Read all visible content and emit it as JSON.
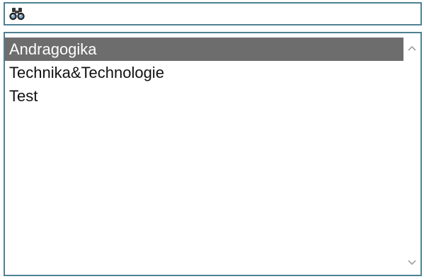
{
  "search": {
    "icon": "binoculars-icon",
    "value": "",
    "placeholder": ""
  },
  "list": {
    "items": [
      {
        "label": "Andragogika",
        "selected": true
      },
      {
        "label": "Technika&Technologie",
        "selected": false
      },
      {
        "label": "Test",
        "selected": false
      }
    ]
  },
  "scrollbar": {
    "up_icon": "scroll-up-arrow-icon",
    "down_icon": "scroll-down-arrow-icon"
  },
  "colors": {
    "border": "#4f8193",
    "selection": "#6d6d6d",
    "selection_text": "#ffffff"
  }
}
